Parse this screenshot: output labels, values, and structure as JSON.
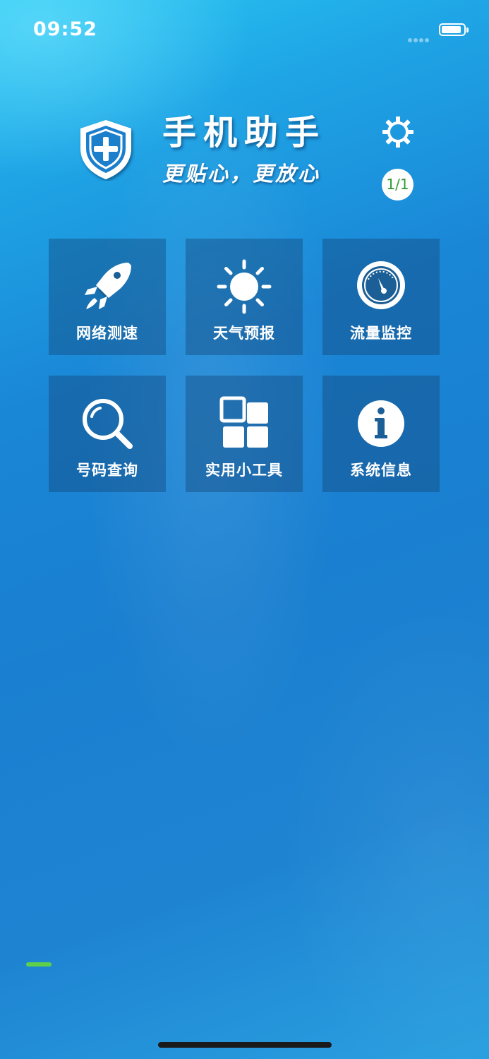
{
  "status_bar": {
    "time": "09:52",
    "battery_level": 0.9
  },
  "header": {
    "title": "手机助手",
    "slogan": "更贴心，更放心",
    "logo_icon": "shield-plus-icon",
    "settings_icon": "gear-icon",
    "page_indicator": "1/1"
  },
  "tiles": [
    {
      "label": "网络测速",
      "icon": "rocket-icon"
    },
    {
      "label": "天气预报",
      "icon": "sun-icon"
    },
    {
      "label": "流量监控",
      "icon": "gauge-icon"
    },
    {
      "label": "号码查询",
      "icon": "magnifier-icon"
    },
    {
      "label": "实用小工具",
      "icon": "grid-tools-icon"
    },
    {
      "label": "系统信息",
      "icon": "info-icon"
    }
  ],
  "colors": {
    "background_top": "#2bc8f2",
    "background_main": "#1a7fd0",
    "tile_background": "#14467a",
    "badge_text": "#2e9a33",
    "progress_accent": "#5fd04a"
  }
}
